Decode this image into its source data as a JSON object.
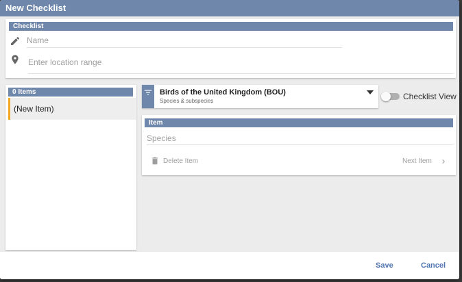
{
  "dialog": {
    "title": "New Checklist"
  },
  "checklist_section": {
    "header": "Checklist",
    "name_placeholder": "Name",
    "location_placeholder": "Enter location range"
  },
  "items_panel": {
    "header": "0 Items",
    "items": [
      {
        "label": "(New Item)"
      }
    ]
  },
  "taxonomy": {
    "title": "Birds of the United Kingdom (BOU)",
    "subtitle": "Species & subspecies",
    "checklist_view_label": "Checklist View",
    "checklist_view_on": false
  },
  "item_section": {
    "header": "Item",
    "species_placeholder": "Species",
    "delete_label": "Delete Item",
    "next_label": "Next Item"
  },
  "footer": {
    "save_label": "Save",
    "cancel_label": "Cancel"
  },
  "icons": {
    "name_field": "pencil-icon",
    "location_field": "map-pin-icon",
    "taxonomy_filter": "filter-icon",
    "dropdown": "caret-down-icon",
    "delete": "trash-icon",
    "next": "chevron-right-icon"
  },
  "colors": {
    "header_blue": "#6f87ab",
    "accent_orange": "#f5a623",
    "button_blue": "#5277b0"
  }
}
